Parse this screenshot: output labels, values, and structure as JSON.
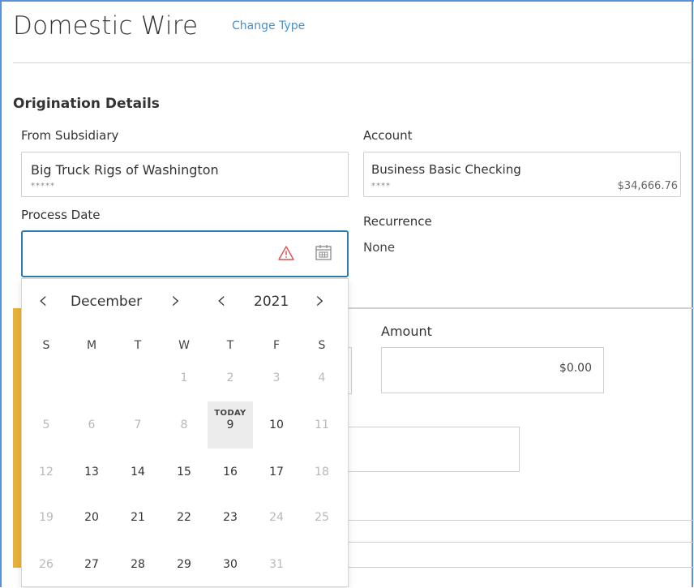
{
  "header": {
    "title": "Domestic Wire",
    "change_type": "Change Type"
  },
  "origination": {
    "section_title": "Origination Details",
    "from_subsidiary": {
      "label": "From Subsidiary",
      "value": "Big Truck Rigs of Washington",
      "masked": "*****"
    },
    "account": {
      "label": "Account",
      "value": "Business Basic Checking",
      "masked": "****",
      "balance": "$34,666.76"
    },
    "process_date": {
      "label": "Process Date",
      "value": ""
    },
    "recurrence": {
      "label": "Recurrence",
      "value": "None"
    }
  },
  "amount": {
    "label": "Amount",
    "value": "$0.00"
  },
  "calendar": {
    "month": "December",
    "year": "2021",
    "weekdays": [
      "S",
      "M",
      "T",
      "W",
      "T",
      "F",
      "S"
    ],
    "today_label": "TODAY",
    "prev_month_icon": "chevron-left-icon",
    "next_month_icon": "chevron-right-icon",
    "weeks": [
      [
        "",
        "",
        "",
        "1",
        "2",
        "3",
        "4"
      ],
      [
        "5",
        "6",
        "7",
        "8",
        "9",
        "10",
        "11"
      ],
      [
        "12",
        "13",
        "14",
        "15",
        "16",
        "17",
        "18"
      ],
      [
        "19",
        "20",
        "21",
        "22",
        "23",
        "24",
        "25"
      ],
      [
        "26",
        "27",
        "28",
        "29",
        "30",
        "31",
        ""
      ]
    ],
    "today": "9",
    "selectable": [
      "9",
      "10",
      "13",
      "14",
      "15",
      "16",
      "17",
      "20",
      "21",
      "22",
      "23",
      "27",
      "28",
      "29",
      "30"
    ]
  },
  "colors": {
    "accent": "#2b7cb3",
    "link": "#4a90c8",
    "warning": "#d9534f",
    "highlight_bar": "#e8b23a"
  },
  "icons": {
    "date_warning": "warning-icon",
    "date_picker": "calendar-icon"
  }
}
